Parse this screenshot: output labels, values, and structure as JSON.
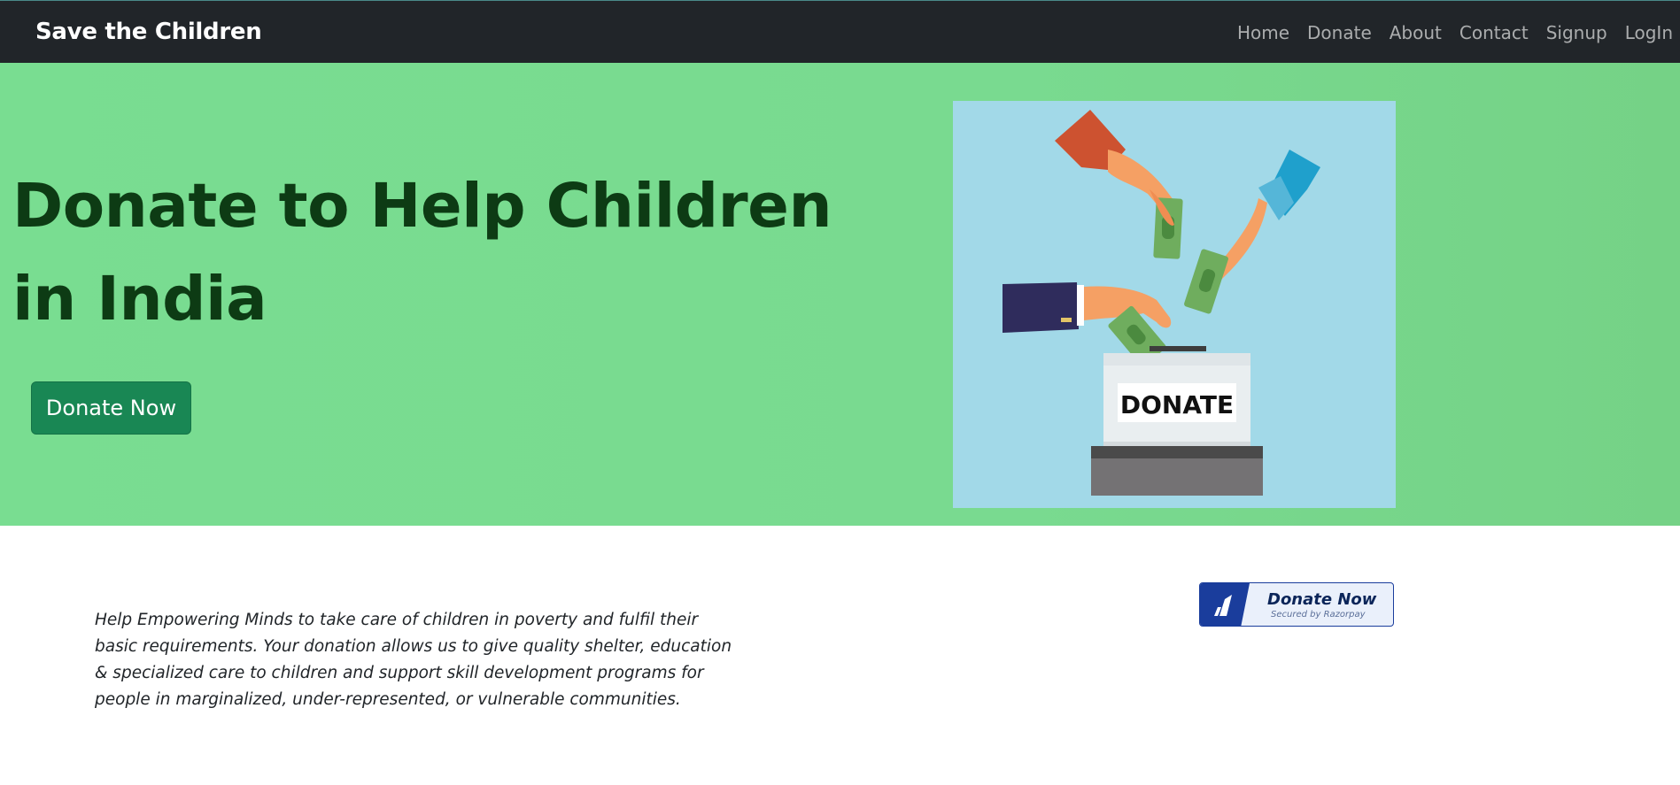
{
  "navbar": {
    "brand": "Save the Children",
    "links": [
      "Home",
      "Donate",
      "About",
      "Contact",
      "Signup",
      "LogIn"
    ]
  },
  "hero": {
    "title": "Donate to Help Children in India",
    "button_label": "Donate Now",
    "image_label": "DONATE"
  },
  "content": {
    "description": "Help Empowering Minds to take care of children in poverty and fulfil their basic requirements. Your donation allows us to give quality shelter, education & specialized care to children and support skill development programs for people in marginalized, under-represented, or vulnerable communities."
  },
  "razorpay_button": {
    "label": "Donate Now",
    "sublabel": "Secured by Razorpay",
    "icon": "razorpay-logo-icon"
  },
  "colors": {
    "navbar_bg": "#212529",
    "hero_bg": "#79dd91",
    "hero_title": "#0d3b14",
    "primary_button": "#198754",
    "razorpay_blue": "#1a3d9c"
  }
}
